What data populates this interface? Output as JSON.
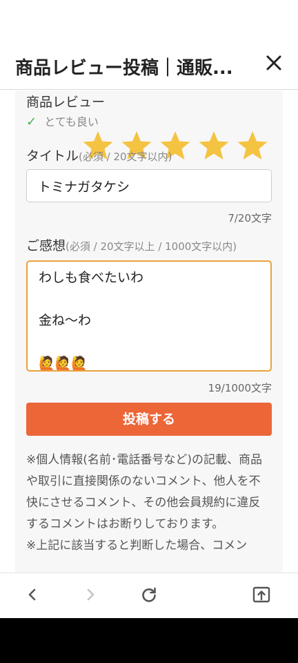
{
  "header": {
    "title": "商品レビュー投稿｜通販..."
  },
  "review": {
    "heading": "商品レビュー",
    "rating_label": "とても良い",
    "rating": 5,
    "max_rating": 5,
    "star_color": "#f5c342"
  },
  "title_field": {
    "label": "タイトル",
    "hint": "(必須 / 20文字以内)",
    "value": "トミナガタケシ",
    "counter": "7/20文字"
  },
  "comment_field": {
    "label": "ご感想",
    "hint": "(必須 / 20文字以上 / 1000文字以内)",
    "lines": [
      "わしも食べたいわ",
      "",
      "金ね〜わ",
      "",
      "🙋🙋🙋"
    ],
    "counter": "19/1000文字"
  },
  "submit": {
    "label": "投稿する",
    "color": "#ec6638"
  },
  "notice": {
    "text": "※個人情報(名前･電話番号など)の記載、商品や取引に直接関係のないコメント、他人を不快にさせるコメント、その他会員規約に違反するコメントはお断りしております。",
    "text2": "※上記に該当すると判断した場合、コメン"
  },
  "browser": {
    "icons": [
      "back-icon",
      "forward-icon",
      "reload-icon",
      "share-icon"
    ]
  }
}
